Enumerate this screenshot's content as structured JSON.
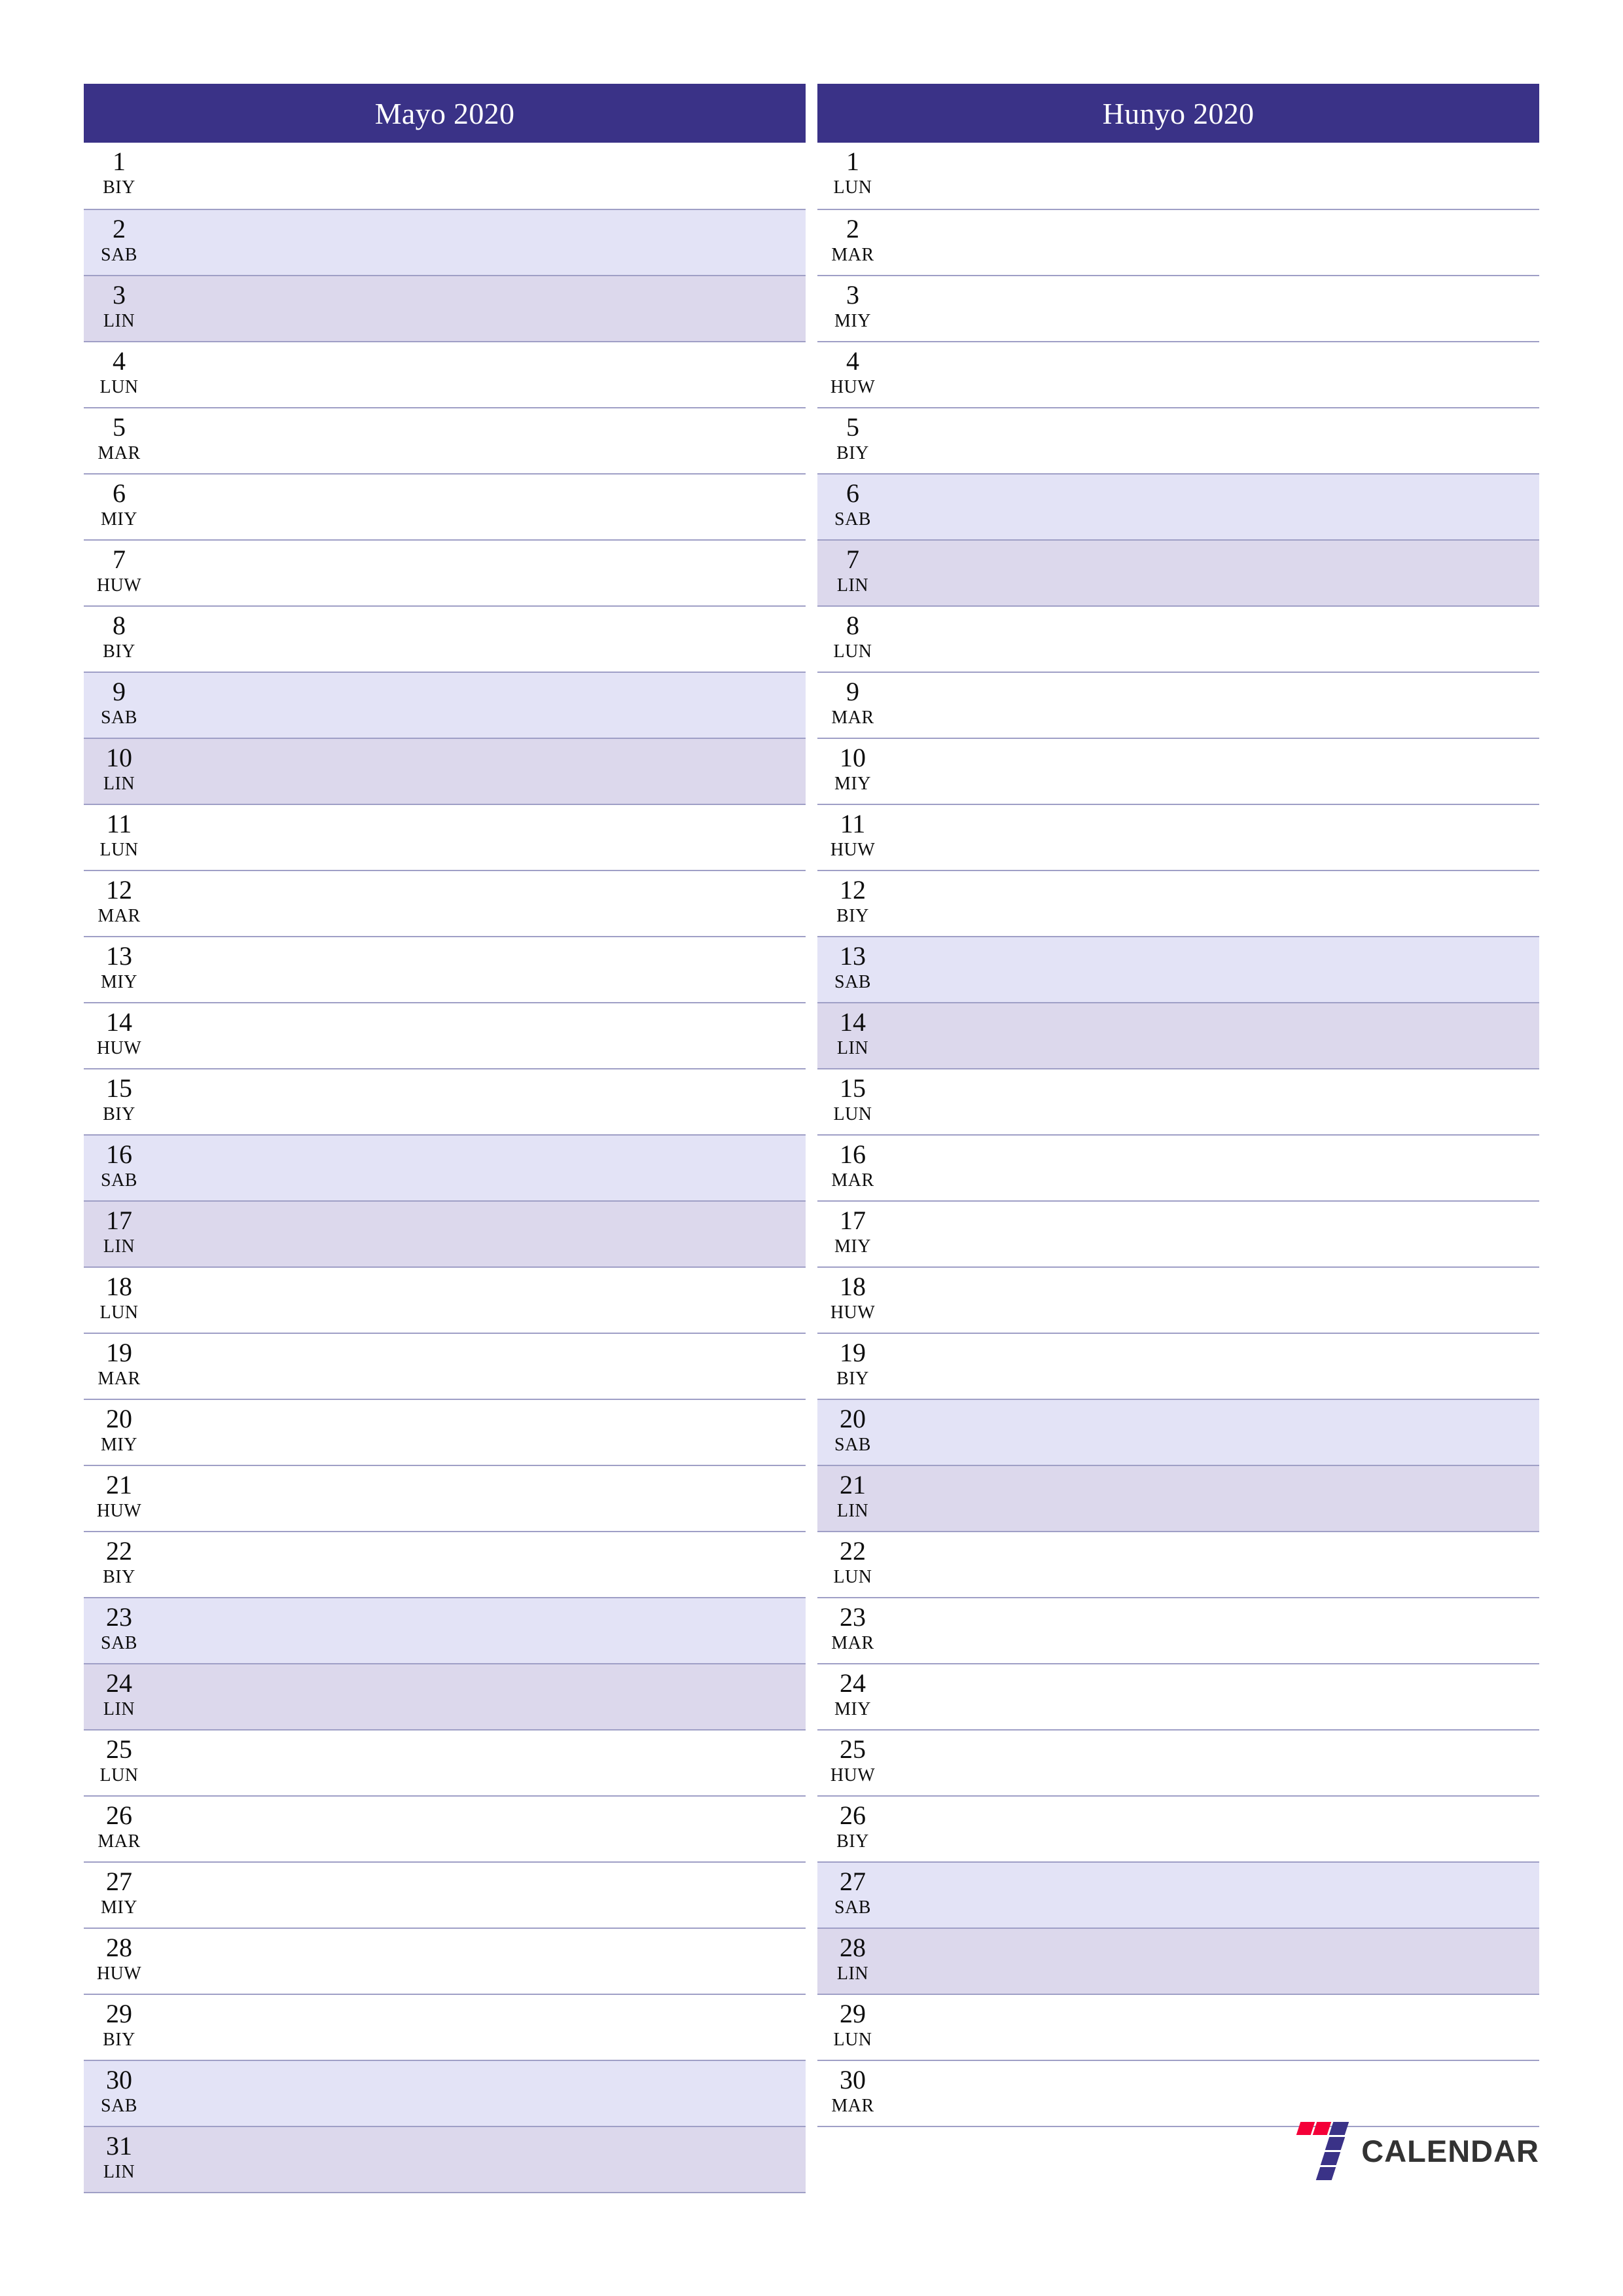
{
  "page": {
    "orientation": "portrait",
    "layout": "two-month-vertical-planner"
  },
  "colors": {
    "header_bg": "#3a3287",
    "header_text": "#ffffff",
    "saturday_bg": "#e3e3f6",
    "sunday_bg": "#dcd8ec",
    "rule": "#9f9fc6",
    "day_text": "#0d0d0d",
    "logo_red": "#f4癸0033",
    "logo_blue": "#3a3287",
    "brand_text": "#333333"
  },
  "months": [
    {
      "title": "Mayo 2020",
      "name": "Mayo",
      "year": "2020",
      "days": [
        {
          "num": "1",
          "abbr": "BIY",
          "kind": "weekday"
        },
        {
          "num": "2",
          "abbr": "SAB",
          "kind": "sat"
        },
        {
          "num": "3",
          "abbr": "LIN",
          "kind": "sun"
        },
        {
          "num": "4",
          "abbr": "LUN",
          "kind": "weekday"
        },
        {
          "num": "5",
          "abbr": "MAR",
          "kind": "weekday"
        },
        {
          "num": "6",
          "abbr": "MIY",
          "kind": "weekday"
        },
        {
          "num": "7",
          "abbr": "HUW",
          "kind": "weekday"
        },
        {
          "num": "8",
          "abbr": "BIY",
          "kind": "weekday"
        },
        {
          "num": "9",
          "abbr": "SAB",
          "kind": "sat"
        },
        {
          "num": "10",
          "abbr": "LIN",
          "kind": "sun"
        },
        {
          "num": "11",
          "abbr": "LUN",
          "kind": "weekday"
        },
        {
          "num": "12",
          "abbr": "MAR",
          "kind": "weekday"
        },
        {
          "num": "13",
          "abbr": "MIY",
          "kind": "weekday"
        },
        {
          "num": "14",
          "abbr": "HUW",
          "kind": "weekday"
        },
        {
          "num": "15",
          "abbr": "BIY",
          "kind": "weekday"
        },
        {
          "num": "16",
          "abbr": "SAB",
          "kind": "sat"
        },
        {
          "num": "17",
          "abbr": "LIN",
          "kind": "sun"
        },
        {
          "num": "18",
          "abbr": "LUN",
          "kind": "weekday"
        },
        {
          "num": "19",
          "abbr": "MAR",
          "kind": "weekday"
        },
        {
          "num": "20",
          "abbr": "MIY",
          "kind": "weekday"
        },
        {
          "num": "21",
          "abbr": "HUW",
          "kind": "weekday"
        },
        {
          "num": "22",
          "abbr": "BIY",
          "kind": "weekday"
        },
        {
          "num": "23",
          "abbr": "SAB",
          "kind": "sat"
        },
        {
          "num": "24",
          "abbr": "LIN",
          "kind": "sun"
        },
        {
          "num": "25",
          "abbr": "LUN",
          "kind": "weekday"
        },
        {
          "num": "26",
          "abbr": "MAR",
          "kind": "weekday"
        },
        {
          "num": "27",
          "abbr": "MIY",
          "kind": "weekday"
        },
        {
          "num": "28",
          "abbr": "HUW",
          "kind": "weekday"
        },
        {
          "num": "29",
          "abbr": "BIY",
          "kind": "weekday"
        },
        {
          "num": "30",
          "abbr": "SAB",
          "kind": "sat"
        },
        {
          "num": "31",
          "abbr": "LIN",
          "kind": "sun"
        }
      ]
    },
    {
      "title": "Hunyo 2020",
      "name": "Hunyo",
      "year": "2020",
      "days": [
        {
          "num": "1",
          "abbr": "LUN",
          "kind": "weekday"
        },
        {
          "num": "2",
          "abbr": "MAR",
          "kind": "weekday"
        },
        {
          "num": "3",
          "abbr": "MIY",
          "kind": "weekday"
        },
        {
          "num": "4",
          "abbr": "HUW",
          "kind": "weekday"
        },
        {
          "num": "5",
          "abbr": "BIY",
          "kind": "weekday"
        },
        {
          "num": "6",
          "abbr": "SAB",
          "kind": "sat"
        },
        {
          "num": "7",
          "abbr": "LIN",
          "kind": "sun"
        },
        {
          "num": "8",
          "abbr": "LUN",
          "kind": "weekday"
        },
        {
          "num": "9",
          "abbr": "MAR",
          "kind": "weekday"
        },
        {
          "num": "10",
          "abbr": "MIY",
          "kind": "weekday"
        },
        {
          "num": "11",
          "abbr": "HUW",
          "kind": "weekday"
        },
        {
          "num": "12",
          "abbr": "BIY",
          "kind": "weekday"
        },
        {
          "num": "13",
          "abbr": "SAB",
          "kind": "sat"
        },
        {
          "num": "14",
          "abbr": "LIN",
          "kind": "sun"
        },
        {
          "num": "15",
          "abbr": "LUN",
          "kind": "weekday"
        },
        {
          "num": "16",
          "abbr": "MAR",
          "kind": "weekday"
        },
        {
          "num": "17",
          "abbr": "MIY",
          "kind": "weekday"
        },
        {
          "num": "18",
          "abbr": "HUW",
          "kind": "weekday"
        },
        {
          "num": "19",
          "abbr": "BIY",
          "kind": "weekday"
        },
        {
          "num": "20",
          "abbr": "SAB",
          "kind": "sat"
        },
        {
          "num": "21",
          "abbr": "LIN",
          "kind": "sun"
        },
        {
          "num": "22",
          "abbr": "LUN",
          "kind": "weekday"
        },
        {
          "num": "23",
          "abbr": "MAR",
          "kind": "weekday"
        },
        {
          "num": "24",
          "abbr": "MIY",
          "kind": "weekday"
        },
        {
          "num": "25",
          "abbr": "HUW",
          "kind": "weekday"
        },
        {
          "num": "26",
          "abbr": "BIY",
          "kind": "weekday"
        },
        {
          "num": "27",
          "abbr": "SAB",
          "kind": "sat"
        },
        {
          "num": "28",
          "abbr": "LIN",
          "kind": "sun"
        },
        {
          "num": "29",
          "abbr": "LUN",
          "kind": "weekday"
        },
        {
          "num": "30",
          "abbr": "MAR",
          "kind": "weekday"
        }
      ]
    }
  ],
  "brand": {
    "mark": "seven-logo-icon",
    "name": "CALENDAR"
  }
}
